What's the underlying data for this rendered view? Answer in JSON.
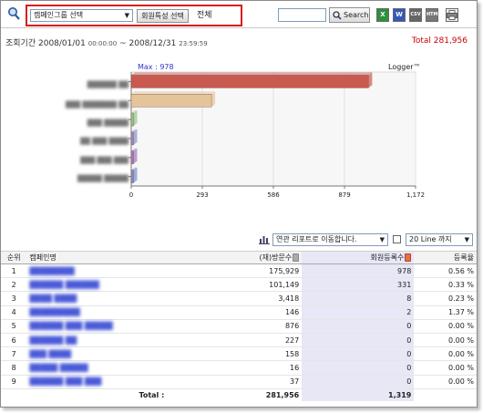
{
  "toolbar": {
    "group_select": "캠페인그룹 선택",
    "attr_button": "회원특성 선택",
    "attr_value": "전체",
    "search_placeholder": "",
    "search_label": "Search",
    "export_icons": [
      "excel-icon",
      "word-icon",
      "csv-icon",
      "html-icon",
      "print-icon"
    ]
  },
  "period": {
    "label": "조회기간",
    "start_date": "2008/01/01",
    "start_time": "00:00:00",
    "sep": "~",
    "end_date": "2008/12/31",
    "end_time": "23:59:59"
  },
  "total_top": "Total 281,956",
  "chart_data": {
    "type": "bar",
    "orientation": "horizontal",
    "max_label": "Max : 978",
    "brand": "Logger™",
    "categories": [
      "",
      "",
      "",
      "",
      "",
      ""
    ],
    "values": [
      978,
      331,
      8,
      2,
      0,
      0
    ],
    "xticks": [
      "0",
      "293",
      "586",
      "879",
      "1,172"
    ],
    "xlim": [
      0,
      1172
    ],
    "colors": [
      "#c85a50",
      "#e4c49a",
      "#8fc887",
      "#8e8ec8",
      "#a07ac0",
      "#7c8ec8"
    ]
  },
  "controls": {
    "report_select": "연관 리포트로 이동합니다.",
    "line_select": "20 Line 까지"
  },
  "table": {
    "headers": {
      "rank": "순위",
      "name": "캠페인명",
      "visits": "(재)방문수",
      "registrations": "회원등록수",
      "rate": "등록율"
    },
    "rows": [
      {
        "rank": "1",
        "name": "",
        "visits": "175,929",
        "reg": "978",
        "rate": "0.56 %"
      },
      {
        "rank": "2",
        "name": "",
        "visits": "101,149",
        "reg": "331",
        "rate": "0.33 %"
      },
      {
        "rank": "3",
        "name": "",
        "visits": "3,418",
        "reg": "8",
        "rate": "0.23 %"
      },
      {
        "rank": "4",
        "name": "",
        "visits": "146",
        "reg": "2",
        "rate": "1.37 %"
      },
      {
        "rank": "5",
        "name": "",
        "visits": "876",
        "reg": "0",
        "rate": "0.00 %"
      },
      {
        "rank": "6",
        "name": "",
        "visits": "227",
        "reg": "0",
        "rate": "0.00 %"
      },
      {
        "rank": "7",
        "name": "",
        "visits": "158",
        "reg": "0",
        "rate": "0.00 %"
      },
      {
        "rank": "8",
        "name": "",
        "visits": "16",
        "reg": "0",
        "rate": "0.00 %"
      },
      {
        "rank": "9",
        "name": "",
        "visits": "37",
        "reg": "0",
        "rate": "0.00 %"
      }
    ],
    "total": {
      "label": "Total :",
      "visits": "281,956",
      "reg": "1,319"
    }
  }
}
